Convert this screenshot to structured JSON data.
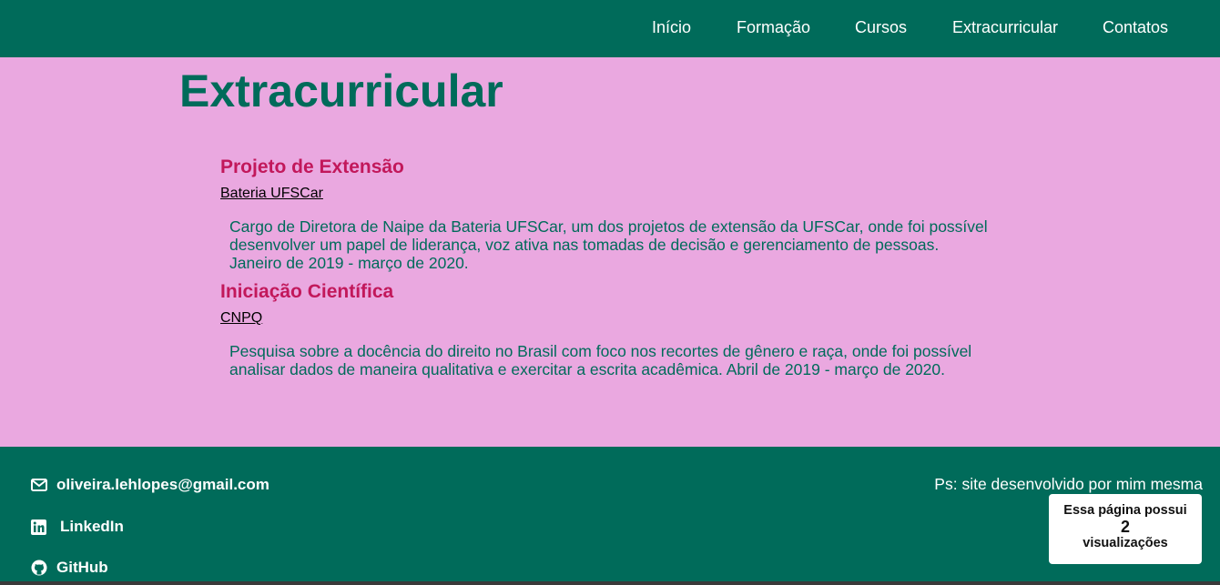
{
  "nav": {
    "items": [
      "Início",
      "Formação",
      "Cursos",
      "Extracurricular",
      "Contatos"
    ]
  },
  "main": {
    "title": "Extracurricular",
    "sections": [
      {
        "heading": "Projeto de Extensão",
        "link": "Bateria UFSCar",
        "description": "Cargo de Diretora de Naipe da Bateria UFSCar, um dos projetos de extensão da UFSCar, onde foi possível desenvolver um papel de liderança, voz ativa nas tomadas de decisão e gerenciamento de pessoas. Janeiro de 2019 - março de 2020."
      },
      {
        "heading": "Iniciação Científica",
        "link": "CNPQ",
        "description": "Pesquisa sobre a docência do direito no Brasil com foco nos recortes de gênero e raça, onde foi possível analisar dados de maneira qualitativa e exercitar a escrita acadêmica. Abril de 2019 - março de 2020."
      }
    ]
  },
  "footer": {
    "email": "oliveira.lehlopes@gmail.com",
    "linkedin": "LinkedIn",
    "github": "GitHub",
    "credit": "Ps: site desenvolvido por mim mesma",
    "views": {
      "line1": "Essa página possui",
      "count": "2",
      "line2": "visualizações"
    }
  },
  "colors": {
    "primary": "#006b5a",
    "background": "#eaa8e0",
    "heading_accent": "#c2185b"
  }
}
